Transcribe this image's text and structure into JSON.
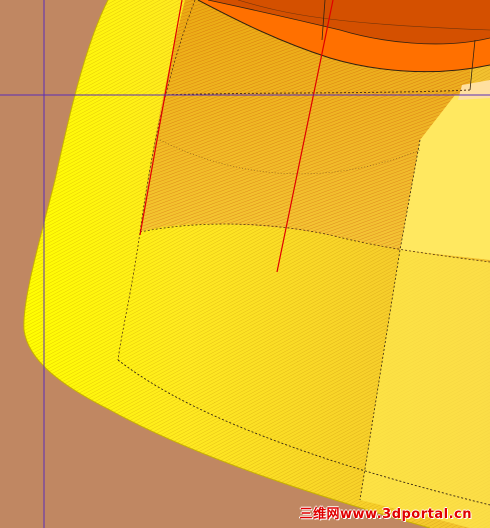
{
  "viewport": {
    "name": "cad-3d-viewport",
    "colors": {
      "background": "#C08762",
      "surface_yellow": "#FFFF00",
      "surface_gold": "#F0C020",
      "surface_light": "#FFE860",
      "surface_pale": "#FFF080",
      "surface_cream": "#FFE0A0",
      "inner_dark": "#D45000",
      "inner_orange": "#FF7000",
      "crosshair": "#5A2CB8",
      "axis_red": "#E00000",
      "edge_dark": "#332211"
    }
  },
  "watermark": {
    "text": "三维网www.3dportal.cn",
    "color": "#E00000"
  }
}
